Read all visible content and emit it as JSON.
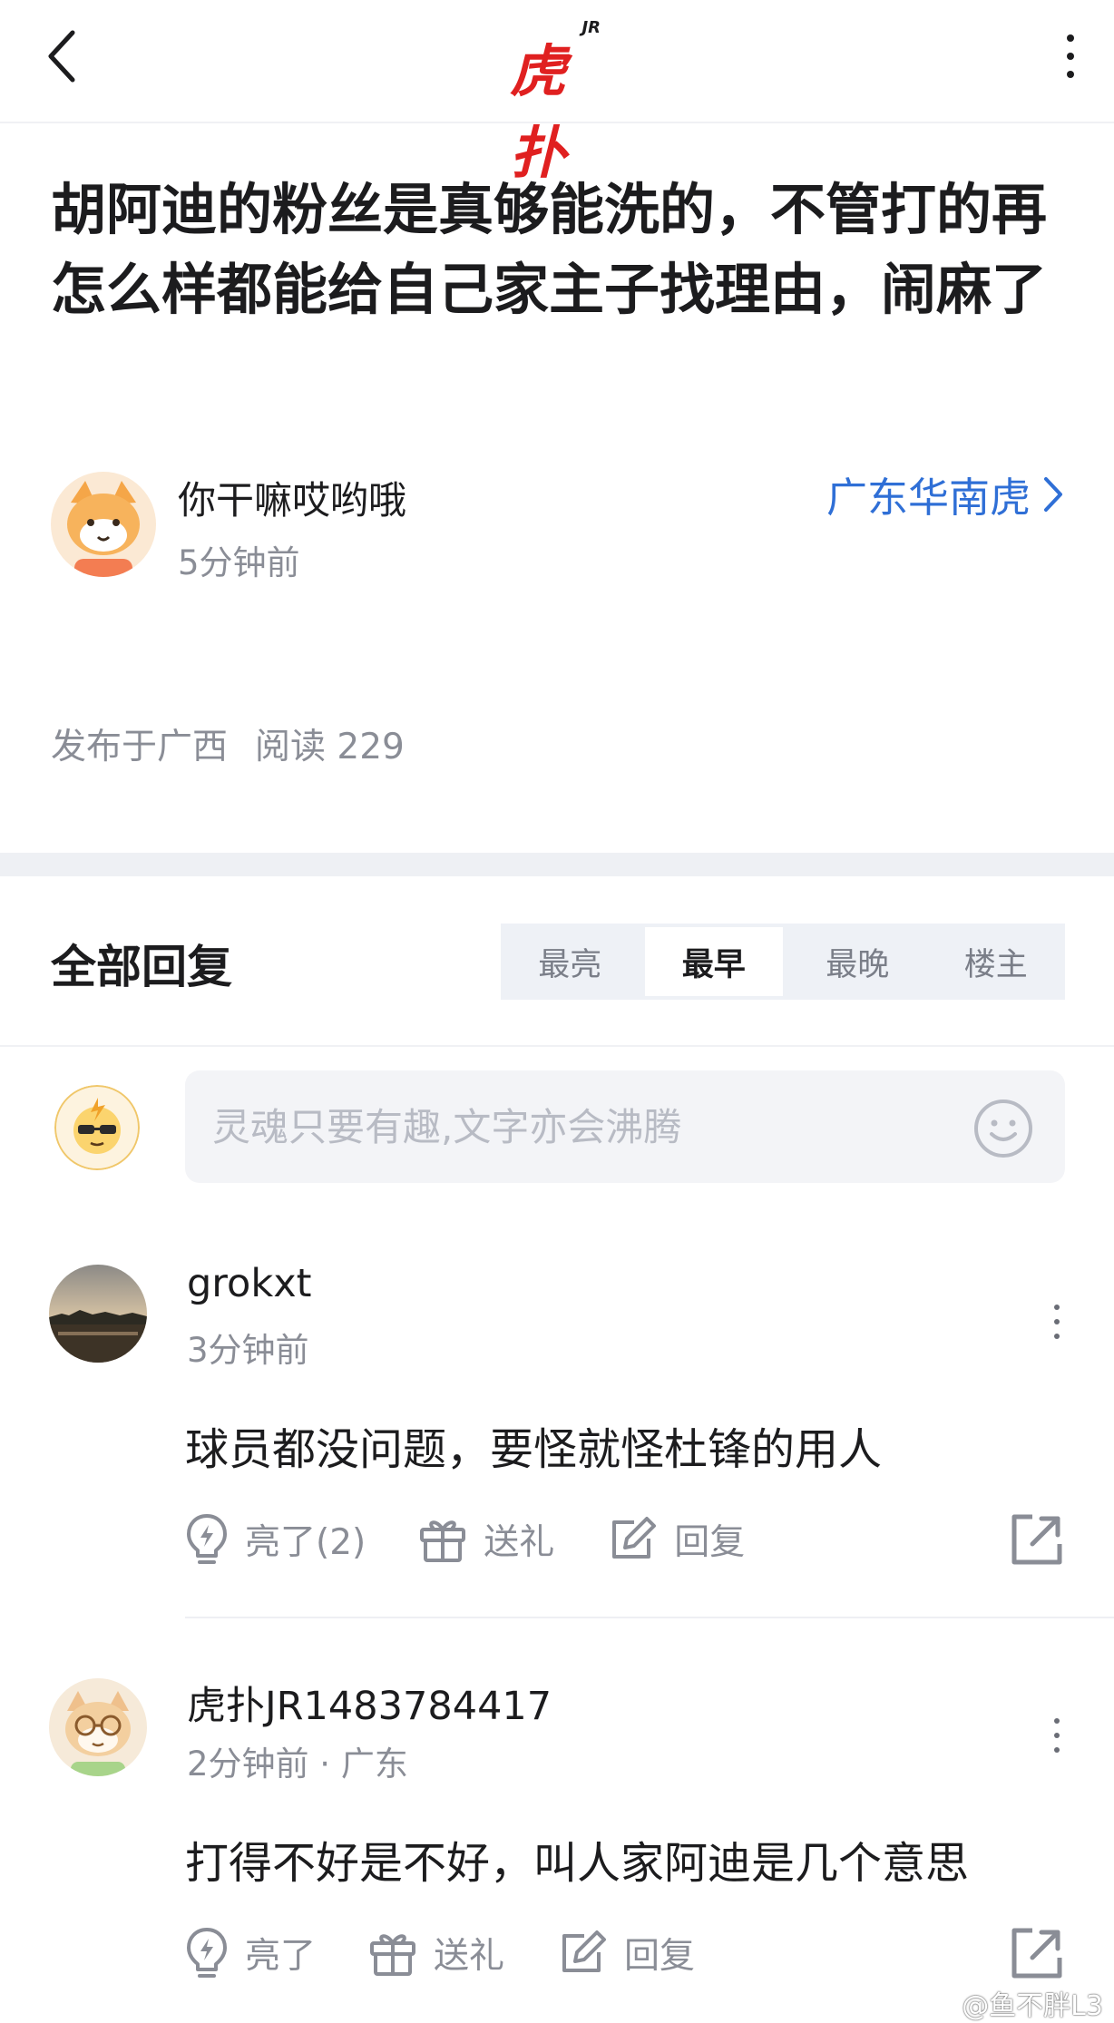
{
  "header": {
    "logo_text": "虎扑",
    "logo_badge": "JR"
  },
  "post": {
    "title": "胡阿迪的粉丝是真够能洗的，不管打的再怎么样都能给自己家主子找理由，闹麻了",
    "author": "你干嘛哎哟哦",
    "time": "5分钟前",
    "board": "广东华南虎",
    "location": "发布于广西",
    "reads": "阅读 229"
  },
  "replies": {
    "title": "全部回复",
    "tabs": [
      "最亮",
      "最早",
      "最晚",
      "楼主"
    ],
    "active_tab": "最早",
    "input_placeholder": "灵魂只要有趣,文字亦会沸腾"
  },
  "comments": [
    {
      "user": "grokxt",
      "time": "3分钟前",
      "text": "球员都没问题，要怪就怪杜锋的用人",
      "light_label": "亮了(2)",
      "gift_label": "送礼",
      "reply_label": "回复"
    },
    {
      "user": "虎扑JR1483784417",
      "time": "2分钟前 · 广东",
      "text": "打得不好是不好，叫人家阿迪是几个意思",
      "light_label": "亮了",
      "gift_label": "送礼",
      "reply_label": "回复"
    }
  ],
  "watermark": "@鱼不胖L3",
  "colors": {
    "brand_red": "#e02020",
    "link_blue": "#2f6fd6",
    "muted_gray": "#8a8d96"
  },
  "icons": [
    "back-arrow-icon",
    "more-vertical-icon",
    "chevron-right-icon",
    "emoji-icon",
    "lightbulb-icon",
    "gift-icon",
    "edit-reply-icon",
    "share-icon"
  ]
}
